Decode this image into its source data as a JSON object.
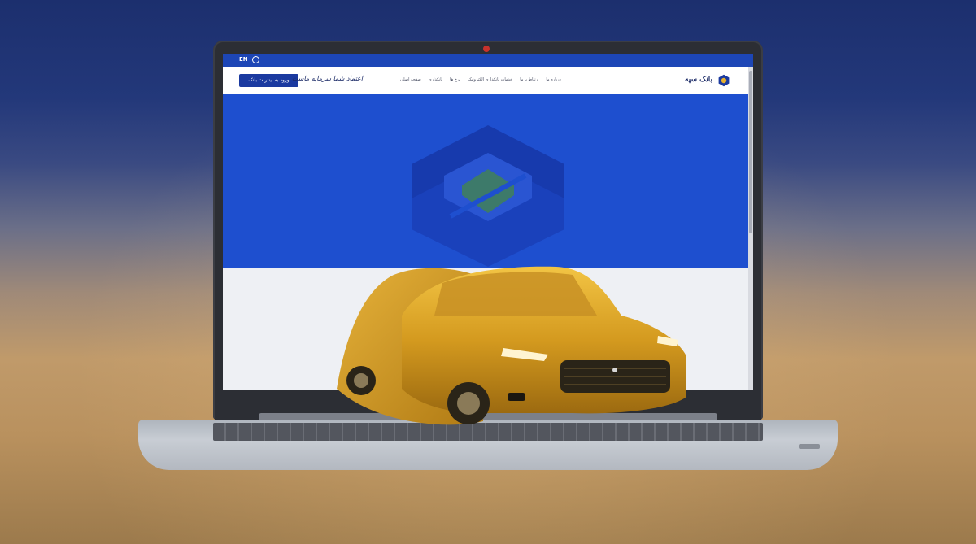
{
  "browser": {
    "language_toggle": "EN",
    "search_icon": "search-icon"
  },
  "site": {
    "brand_name": "بانک سپه",
    "brand_logo_icon": "hexagon-logo-icon",
    "slogan": "اعتماد شما سرمایه ماست",
    "cta_label": "ورود به اینترنت بانک",
    "menu": [
      "صفحه اصلی",
      "بانکداری",
      "نرخ ها",
      "خدمات بانکداری الکترونیک",
      "ارتباط با ما",
      "درباره ما"
    ],
    "hero_logo_icon": "hexagon-logo-icon"
  },
  "colors": {
    "brand_blue": "#1e4fcf",
    "cta_blue": "#1b3aa0",
    "gold": "#d9a62a"
  },
  "illustration": {
    "object": "covered-gold-car"
  }
}
